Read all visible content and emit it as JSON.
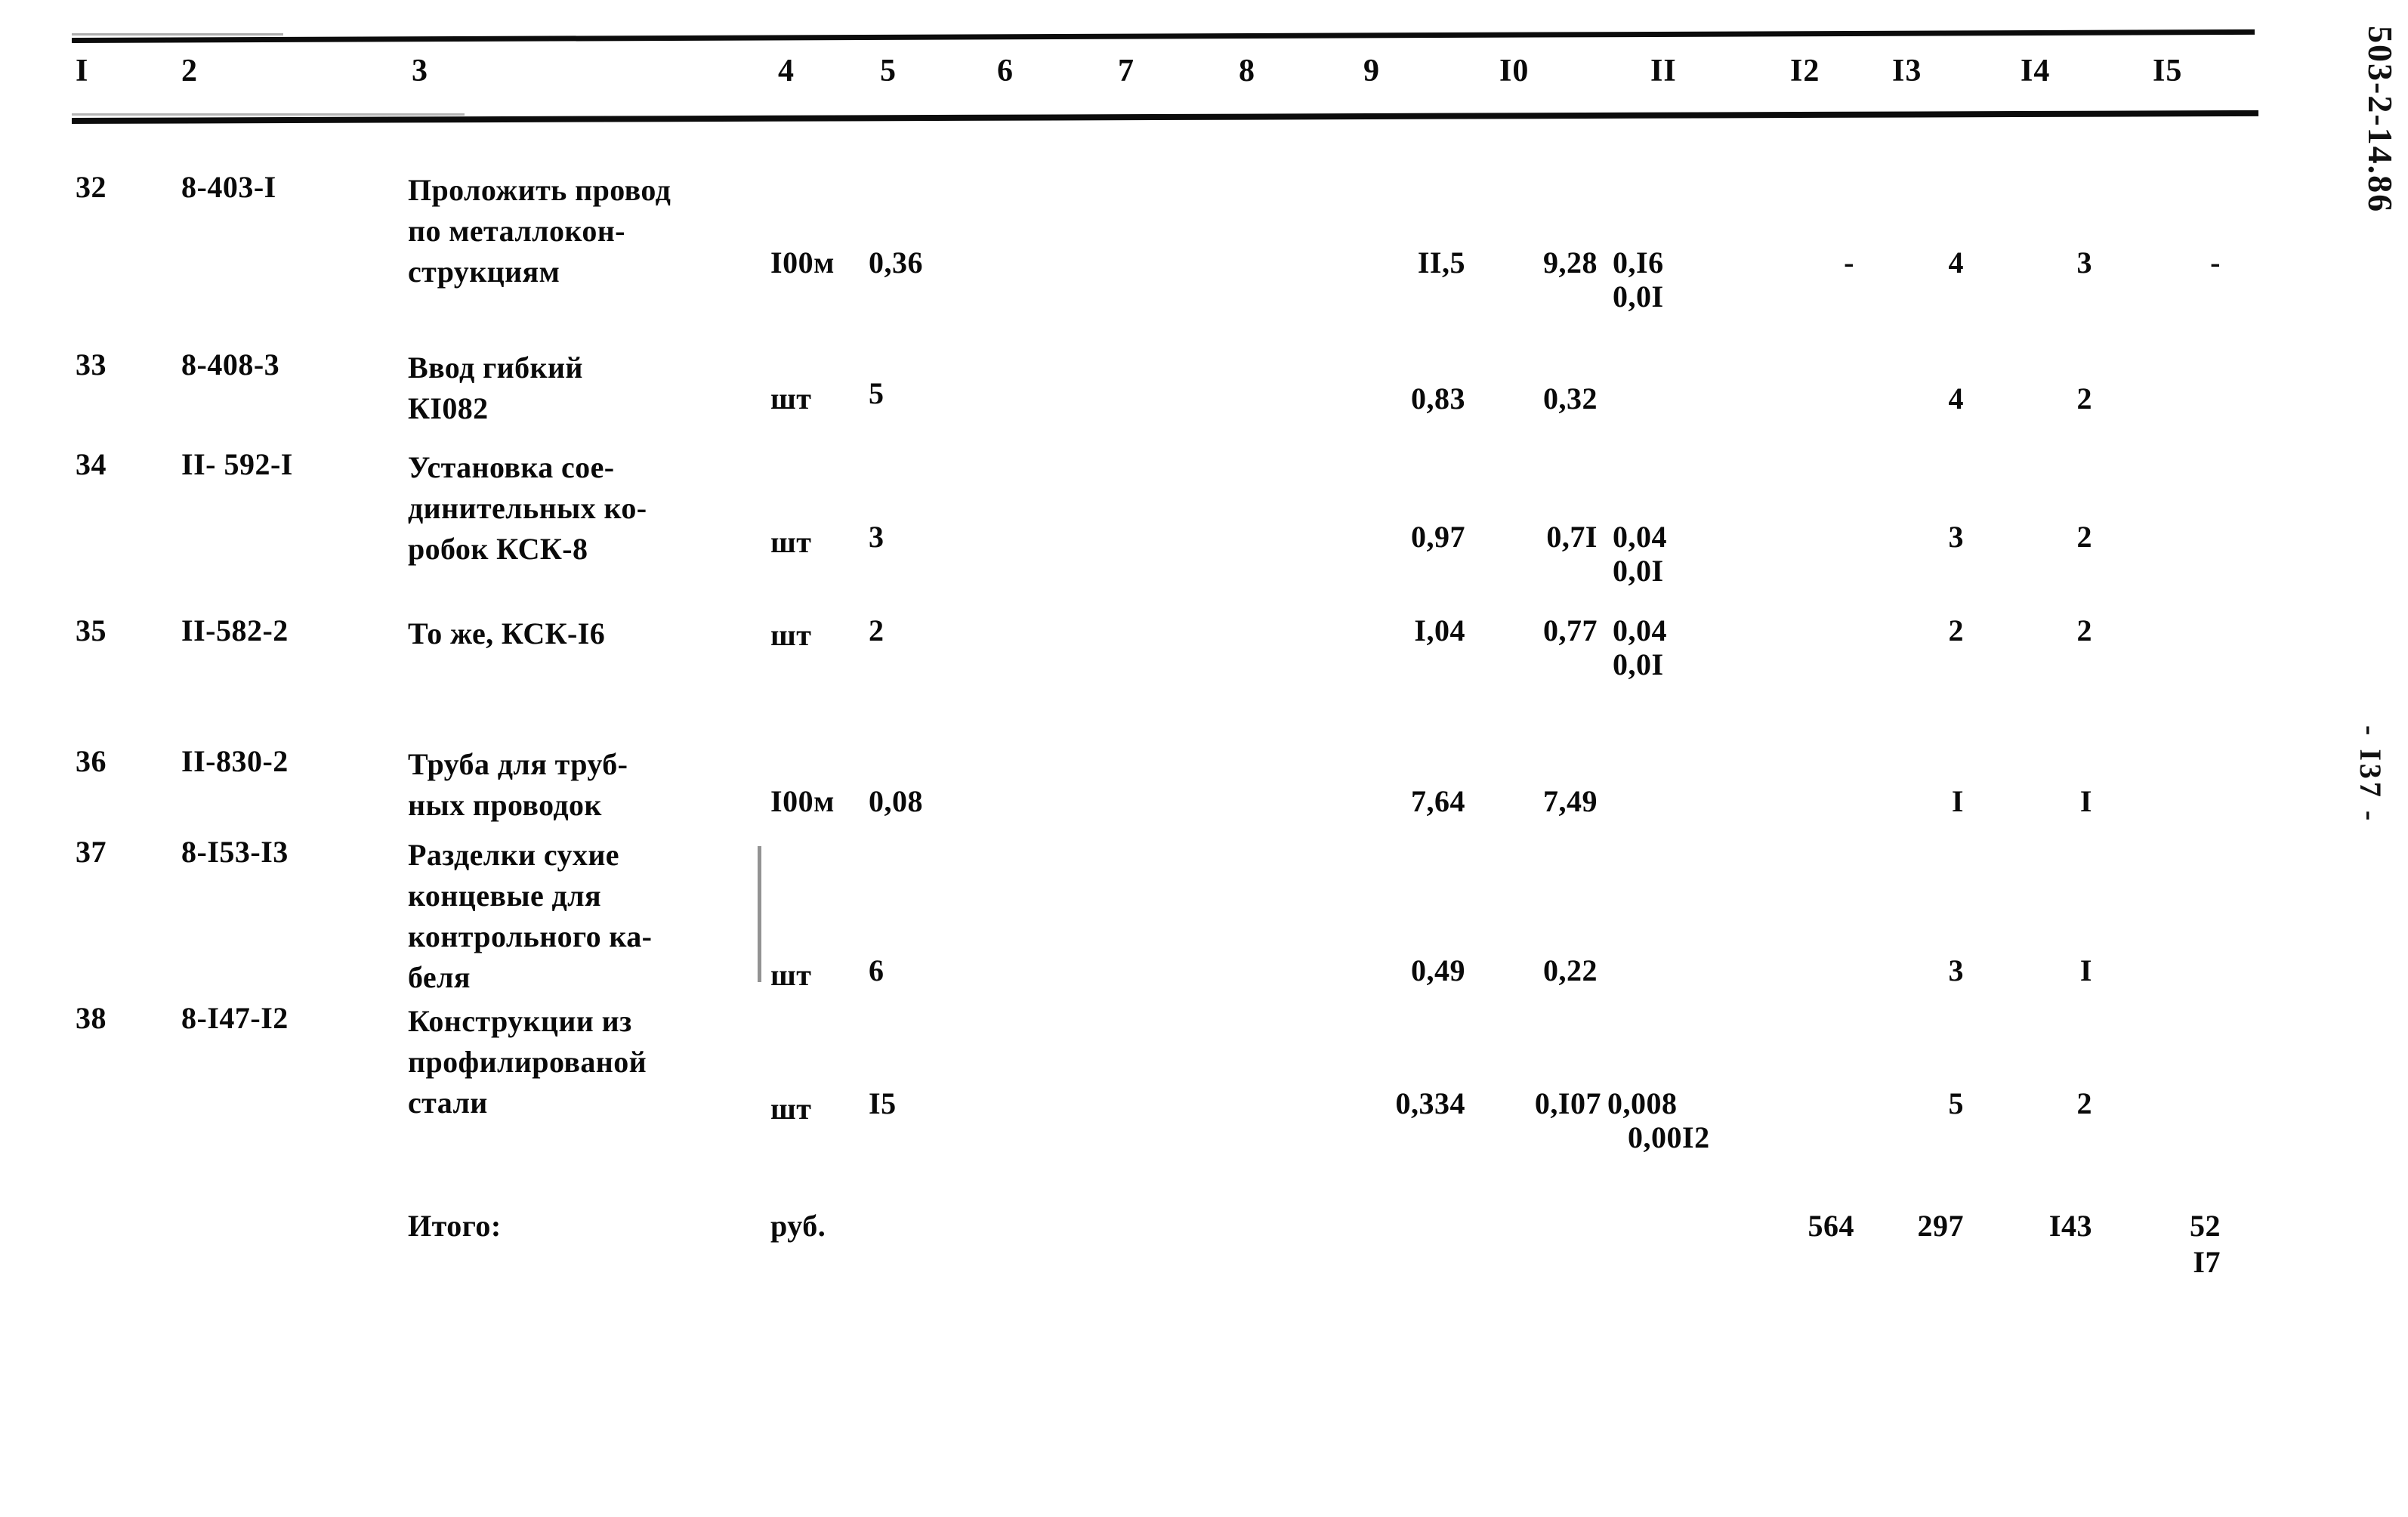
{
  "document": {
    "side_code": "503-2-14.86",
    "page_label": "- I37 -"
  },
  "table": {
    "column_headers": [
      "I",
      "2",
      "3",
      "4",
      "5",
      "6",
      "7",
      "8",
      "9",
      "I0",
      "II",
      "I2",
      "I3",
      "I4",
      "I5"
    ],
    "rows": [
      {
        "num": "32",
        "code": "8-403-I",
        "desc": "Проложить провод\nпо металлокон-\nструкциям",
        "unit": "I00м",
        "qty": "0,36",
        "c9": "II,5",
        "c10": "9,28",
        "c11": "0,I6",
        "c11b": "0,0I",
        "c12": "-",
        "c13": "4",
        "c14": "3",
        "c15": "-"
      },
      {
        "num": "33",
        "code": "8-408-3",
        "desc": "Ввод гибкий\nКI082",
        "unit": "шт",
        "qty": "5",
        "c9": "0,83",
        "c10": "0,32",
        "c11": "",
        "c11b": "",
        "c12": "",
        "c13": "4",
        "c14": "2",
        "c15": ""
      },
      {
        "num": "34",
        "code": "II- 592-I",
        "desc": "Установка сое-\nдинительных ко-\nробок КСК-8",
        "unit": "шт",
        "qty": "3",
        "c9": "0,97",
        "c10": "0,7I",
        "c11": "0,04",
        "c11b": "0,0I",
        "c12": "",
        "c13": "3",
        "c14": "2",
        "c15": ""
      },
      {
        "num": "35",
        "code": "II-582-2",
        "desc": "То же, КСК-I6",
        "unit": "шт",
        "qty": "2",
        "c9": "I,04",
        "c10": "0,77",
        "c11": "0,04",
        "c11b": "0,0I",
        "c12": "",
        "c13": "2",
        "c14": "2",
        "c15": ""
      },
      {
        "num": "36",
        "code": "II-830-2",
        "desc": "Труба для труб-\nных проводок",
        "unit": "I00м",
        "qty": "0,08",
        "c9": "7,64",
        "c10": "7,49",
        "c11": "",
        "c11b": "",
        "c12": "",
        "c13": "I",
        "c14": "I",
        "c15": ""
      },
      {
        "num": "37",
        "code": "8-I53-I3",
        "desc": "Разделки сухие\nконцевые для\nконтрольного ка-\nбеля",
        "unit": "шт",
        "qty": "6",
        "c9": "0,49",
        "c10": "0,22",
        "c11": "",
        "c11b": "",
        "c12": "",
        "c13": "3",
        "c14": "I",
        "c15": ""
      },
      {
        "num": "38",
        "code": "8-I47-I2",
        "desc": "Конструкции из\nпрофилированой\nстали",
        "unit": "шт",
        "qty": "I5",
        "c9": "0,334",
        "c10": "0,I07",
        "c11": "0,008",
        "c11b": "0,00I2",
        "c12": "",
        "c13": "5",
        "c14": "2",
        "c15": ""
      }
    ],
    "total_row": {
      "label": "Итого:",
      "unit": "руб.",
      "c12": "564",
      "c13": "297",
      "c14": "I43",
      "c15": "52",
      "c15b": "I7"
    }
  }
}
